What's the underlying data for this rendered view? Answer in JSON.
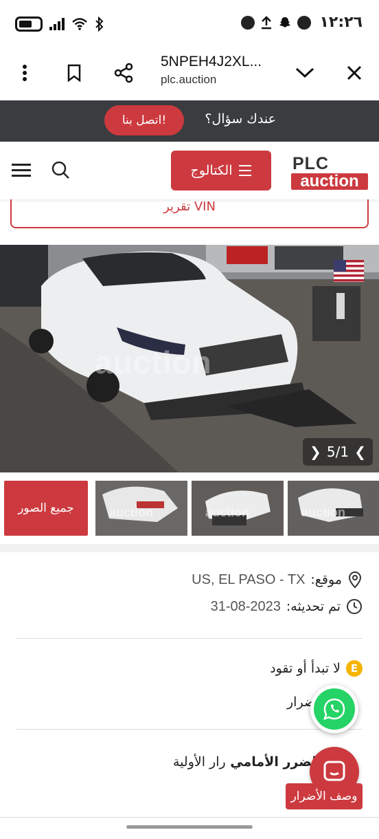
{
  "status_bar": {
    "time": "١٢:٢٦"
  },
  "browser": {
    "title": "5NPEH4J2XL...",
    "url": "plc.auction",
    "icons": [
      "more-vert-icon",
      "bookmark-icon",
      "share-icon",
      "chevron-down-icon",
      "close-icon"
    ]
  },
  "contact": {
    "question": "عندك سؤال؟",
    "button": "اتصل بنا!"
  },
  "header": {
    "logo_top": "PLC",
    "logo_bottom": "auction",
    "catalog_label": "الكتالوج"
  },
  "vin_report": "تقرير VIN",
  "gallery": {
    "watermark": "auction",
    "counter": "5/1",
    "all_photos": "جميع الصور",
    "thumb_watermark": "auction"
  },
  "details": {
    "location_label": "موقع:",
    "location_value": "US, EL PASO - TX",
    "updated_label": "تم تحديثه:",
    "updated_value": "31-08-2023",
    "run_status": "لا تبدأ أو تقود",
    "run_badge": "E",
    "damage_partial": "ضرار",
    "primary_damage_partial": "رار الأولية",
    "primary_damage_value": "الضرر الأمامي",
    "damage_description": "وصف الأضرار"
  },
  "colors": {
    "accent": "#cc3a3f",
    "dark_strip": "#3a3c40",
    "whatsapp": "#25d366"
  }
}
